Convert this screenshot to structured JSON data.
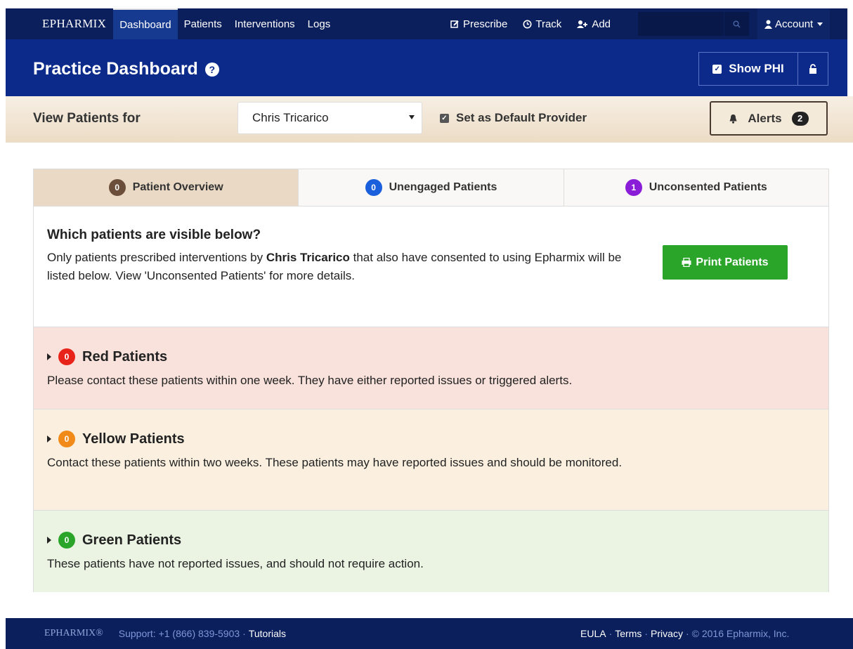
{
  "topbar": {
    "brand": "EPHARMIX",
    "nav": [
      "Dashboard",
      "Patients",
      "Interventions",
      "Logs"
    ],
    "actions": [
      "Prescribe",
      "Track",
      "Add"
    ],
    "account": "Account"
  },
  "header": {
    "title": "Practice Dashboard",
    "show_phi": "Show PHI"
  },
  "provider_bar": {
    "label": "View Patients for",
    "selected_provider": "Chris Tricarico",
    "default_label": "Set as Default Provider",
    "alerts_label": "Alerts",
    "alerts_count": "2"
  },
  "tabs": [
    {
      "label": "Patient Overview",
      "count": "0"
    },
    {
      "label": "Unengaged Patients",
      "count": "0"
    },
    {
      "label": "Unconsented Patients",
      "count": "1"
    }
  ],
  "info": {
    "heading": "Which patients are visible below?",
    "text_before": "Only patients prescribed interventions by ",
    "provider": "Chris Tricarico",
    "text_after": " that also have consented to using Epharmix will be listed below. View 'Unconsented Patients' for more details.",
    "print_label": "Print Patients"
  },
  "groups": [
    {
      "title": "Red Patients",
      "count": "0",
      "description": "Please contact these patients within one week. They have either reported issues or triggered alerts."
    },
    {
      "title": "Yellow Patients",
      "count": "0",
      "description": "Contact these patients within two weeks. These patients may have reported issues and should be monitored."
    },
    {
      "title": "Green Patients",
      "count": "0",
      "description": "These patients have not reported issues, and should not require action."
    }
  ],
  "footer": {
    "brand": "EPHARMIX®",
    "support": "Support: +1 (866) 839-5903",
    "tutorials": "Tutorials",
    "eula": "EULA",
    "terms": "Terms",
    "privacy": "Privacy",
    "copyright": "© 2016 Epharmix, Inc."
  }
}
